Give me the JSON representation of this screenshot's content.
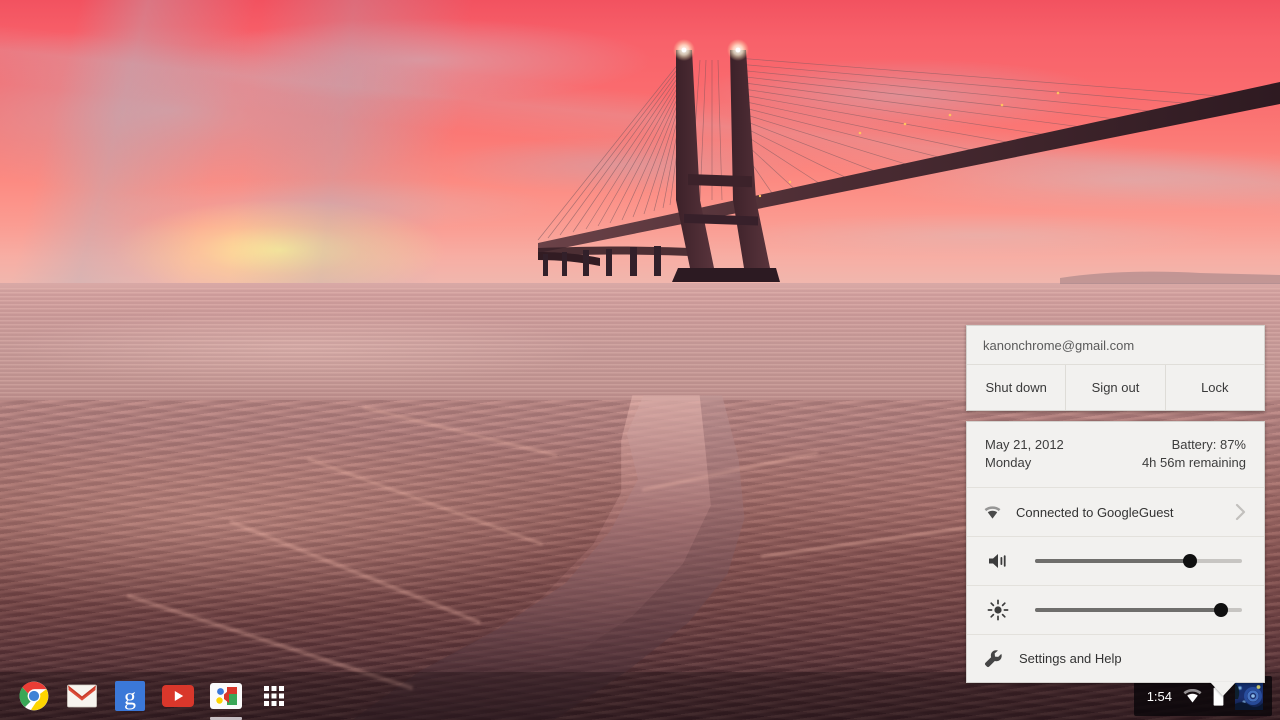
{
  "desktop": {
    "wallpaper_name": "vasco-da-gama-bridge-sunset",
    "accent": "#f25260"
  },
  "tray_popup": {
    "user": {
      "email": "kanonchrome@gmail.com",
      "actions": [
        {
          "label": "Shut down",
          "name": "shut-down-button"
        },
        {
          "label": "Sign out",
          "name": "sign-out-button"
        },
        {
          "label": "Lock",
          "name": "lock-button"
        }
      ]
    },
    "date_row": {
      "date": "May 21, 2012",
      "weekday": "Monday",
      "battery_percent": "Battery: 87%",
      "battery_remaining": "4h 56m remaining"
    },
    "network": {
      "icon": "wifi-icon",
      "label": "Connected to GoogleGuest",
      "chevron": "chevron-right-icon"
    },
    "volume": {
      "icon": "volume-icon",
      "value": 75
    },
    "brightness": {
      "icon": "brightness-icon",
      "value": 90
    },
    "settings": {
      "icon": "wrench-icon",
      "label": "Settings and Help"
    }
  },
  "shelf": {
    "apps": [
      {
        "name": "shelf-app-chrome",
        "label": "Chrome",
        "active": false
      },
      {
        "name": "shelf-app-gmail",
        "label": "Gmail",
        "active": false
      },
      {
        "name": "shelf-app-google-search",
        "label": "Google Search",
        "active": false
      },
      {
        "name": "shelf-app-youtube",
        "label": "YouTube",
        "active": false
      },
      {
        "name": "shelf-app-google-docs",
        "label": "Google Docs",
        "active": true
      },
      {
        "name": "shelf-app-launcher",
        "label": "Apps",
        "active": false
      }
    ],
    "status": {
      "clock": "1:54",
      "wifi_icon": "wifi-icon",
      "battery_icon": "battery-icon",
      "avatar": "user-avatar"
    }
  }
}
